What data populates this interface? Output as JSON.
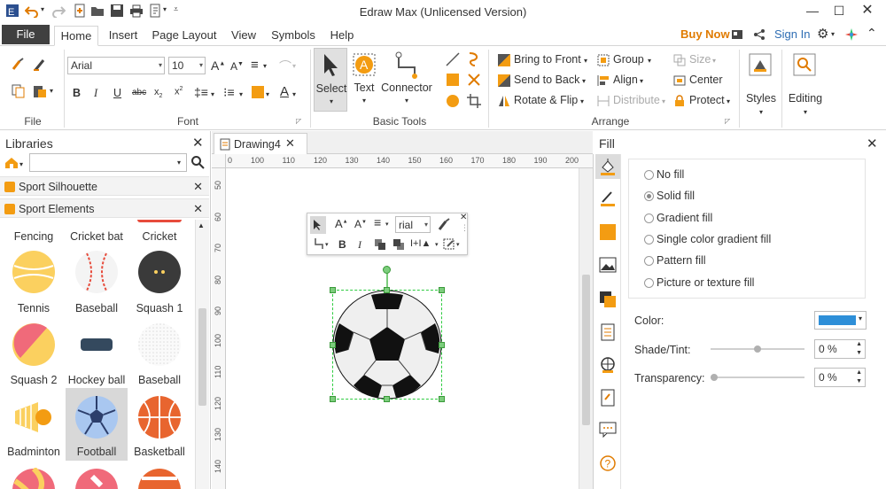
{
  "app": {
    "title": "Edraw Max (Unlicensed Version)"
  },
  "menu": {
    "file": "File",
    "tabs": [
      "Home",
      "Insert",
      "Page Layout",
      "View",
      "Symbols",
      "Help"
    ],
    "buy_now": "Buy Now",
    "sign_in": "Sign In"
  },
  "ribbon": {
    "file_group": "File",
    "font_group": "Font",
    "font_name": "Arial",
    "font_size": "10",
    "basic_tools_group": "Basic Tools",
    "select": "Select",
    "text": "Text",
    "connector": "Connector",
    "arrange_group": "Arrange",
    "bring_to_front": "Bring to Front",
    "send_to_back": "Send to Back",
    "rotate_flip": "Rotate & Flip",
    "group": "Group",
    "align": "Align",
    "distribute": "Distribute",
    "size": "Size",
    "center": "Center",
    "protect": "Protect",
    "styles": "Styles",
    "editing": "Editing"
  },
  "libraries": {
    "title": "Libraries",
    "search_placeholder": "",
    "categories": [
      "Sport Silhouette",
      "Sport Elements"
    ],
    "items": [
      {
        "label": "Fencing"
      },
      {
        "label": "Cricket bat"
      },
      {
        "label": "Cricket"
      },
      {
        "label": "Tennis"
      },
      {
        "label": "Baseball"
      },
      {
        "label": "Squash 1"
      },
      {
        "label": "Squash 2"
      },
      {
        "label": "Hockey ball"
      },
      {
        "label": "Baseball"
      },
      {
        "label": "Badminton"
      },
      {
        "label": "Football"
      },
      {
        "label": "Basketball"
      }
    ]
  },
  "document": {
    "tab": "Drawing4"
  },
  "ruler": {
    "h": [
      "0",
      "100",
      "110",
      "120",
      "130",
      "140",
      "150",
      "160",
      "170",
      "180",
      "190",
      "200"
    ],
    "v": [
      "50",
      "60",
      "70",
      "80",
      "90",
      "100",
      "110",
      "120",
      "130",
      "140"
    ]
  },
  "mini_toolbar": {
    "font": "rial"
  },
  "fill": {
    "title": "Fill",
    "options": [
      "No fill",
      "Solid fill",
      "Gradient fill",
      "Single color gradient fill",
      "Pattern fill",
      "Picture or texture fill"
    ],
    "selected": "Solid fill",
    "color_label": "Color:",
    "color_value": "#2e8fd8",
    "shade_label": "Shade/Tint:",
    "shade_value": "0 %",
    "shade_level": 0.5,
    "transparency_label": "Transparency:",
    "transparency_value": "0 %",
    "transparency_level": 0
  },
  "colors": {
    "accent": "#2e6db3",
    "orange": "#f39c12",
    "buy": "#e07b00"
  }
}
